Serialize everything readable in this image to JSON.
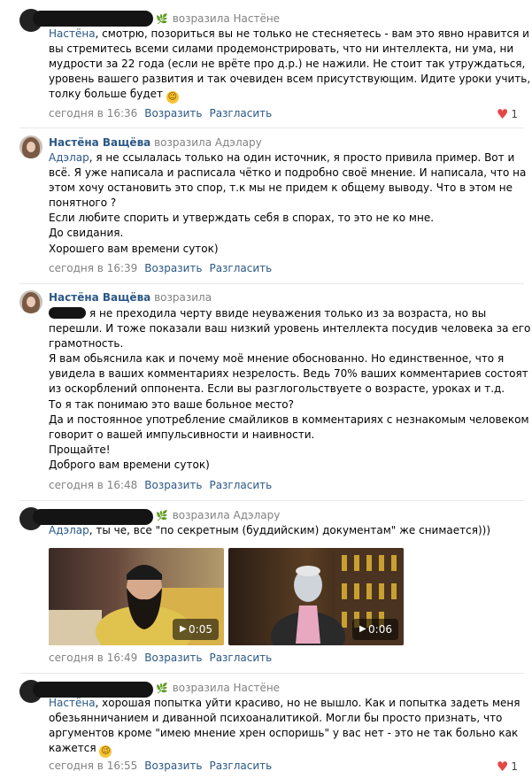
{
  "c1": {
    "action": "возразила Настёне",
    "lines": [
      [
        "Настёна",
        ", смотрю, позориться вы не только не стесняетесь - вам это явно нравится и"
      ],
      [
        "",
        "вы стремитесь всеми силами продемонстрировать, что ни интеллекта, ни ума, ни"
      ],
      [
        "",
        "мудрости за 22 года (если не врёте про д.р.) не нажили. Не стоит так утруждаться,"
      ],
      [
        "",
        "уровень вашего развития и так очевиден всем присутствующим. Идите уроки учить,"
      ],
      [
        "",
        "толку больше будет"
      ]
    ],
    "time": "сегодня в 16:36",
    "reply": "Возразить",
    "disagree": "Разгласить",
    "likes": "1"
  },
  "c2": {
    "name": "Настёна Ващёва",
    "action": "возразила Адэлару",
    "lines": [
      [
        "Адэлар",
        ", я не ссылалась только на один источник, я просто привила пример. Вот и"
      ],
      [
        "",
        "всё. Я уже написала и расписала чётко и подробно своё мнение. И написала, что на"
      ],
      [
        "",
        "этом хочу остановить это спор, т.к мы не придем к общему выводу. Что в этом не"
      ],
      [
        "",
        "понятного ?"
      ],
      [
        "",
        "Если любите спорить и утверждать себя в спорах, то это не ко мне."
      ],
      [
        "",
        "До свидания."
      ],
      [
        "",
        "Хорошего вам времени суток)"
      ]
    ],
    "time": "сегодня в 16:39",
    "reply": "Возразить",
    "disagree": "Разгласить"
  },
  "c3": {
    "name": "Настёна Ващёва",
    "action": "возразила",
    "first": "я не преходила черту ввиде неуважения только из за возраста, но вы",
    "lines": [
      "перешли. И тоже показали ваш низкий уровень интеллекта посудив человека за его",
      "грамотность.",
      "Я вам обьяснила как и почему моё мнение обоснованно. Но единственное, что я",
      "увидела в ваших комментариях незрелость. Ведь 70% ваших комментариев состоят",
      "из оскорблений оппонента. Если вы разглогольствуете о возрасте, уроках и т.д.",
      "То я так понимаю это ваше больное место?",
      "Да и постоянное употребление смайликов в комментариях с незнакомым человеком",
      "говорит о вашей импульсивности и наивности.",
      "Прощайте!",
      "Доброго вам времени суток)"
    ],
    "time": "сегодня в 16:48",
    "reply": "Возразить",
    "disagree": "Разгласить"
  },
  "c4": {
    "action": "возразила Адэлару",
    "mention": "Адэлар",
    "text": ", ты че, все \"по секретным (буддийским) документам\" же снимается)))",
    "video1": "0:05",
    "video2": "0:06",
    "time": "сегодня в 16:49",
    "reply": "Возразить",
    "disagree": "Разгласить"
  },
  "c5": {
    "action": "возразила Настёне",
    "lines": [
      [
        "Настёна",
        ", хорошая попытка уйти красиво, но не вышло. Как и попытка задеть меня"
      ],
      [
        "",
        "обезьянничанием и диванной психоаналитикой. Могли бы просто признать, что"
      ],
      [
        "",
        "аргументов кроме \"имею мнение хрен оспоришь\" у вас нет - это не так больно как"
      ],
      [
        "",
        "кажется"
      ]
    ],
    "time": "сегодня в 16:55",
    "reply": "Возразить",
    "disagree": "Разгласить",
    "likes": "1"
  }
}
